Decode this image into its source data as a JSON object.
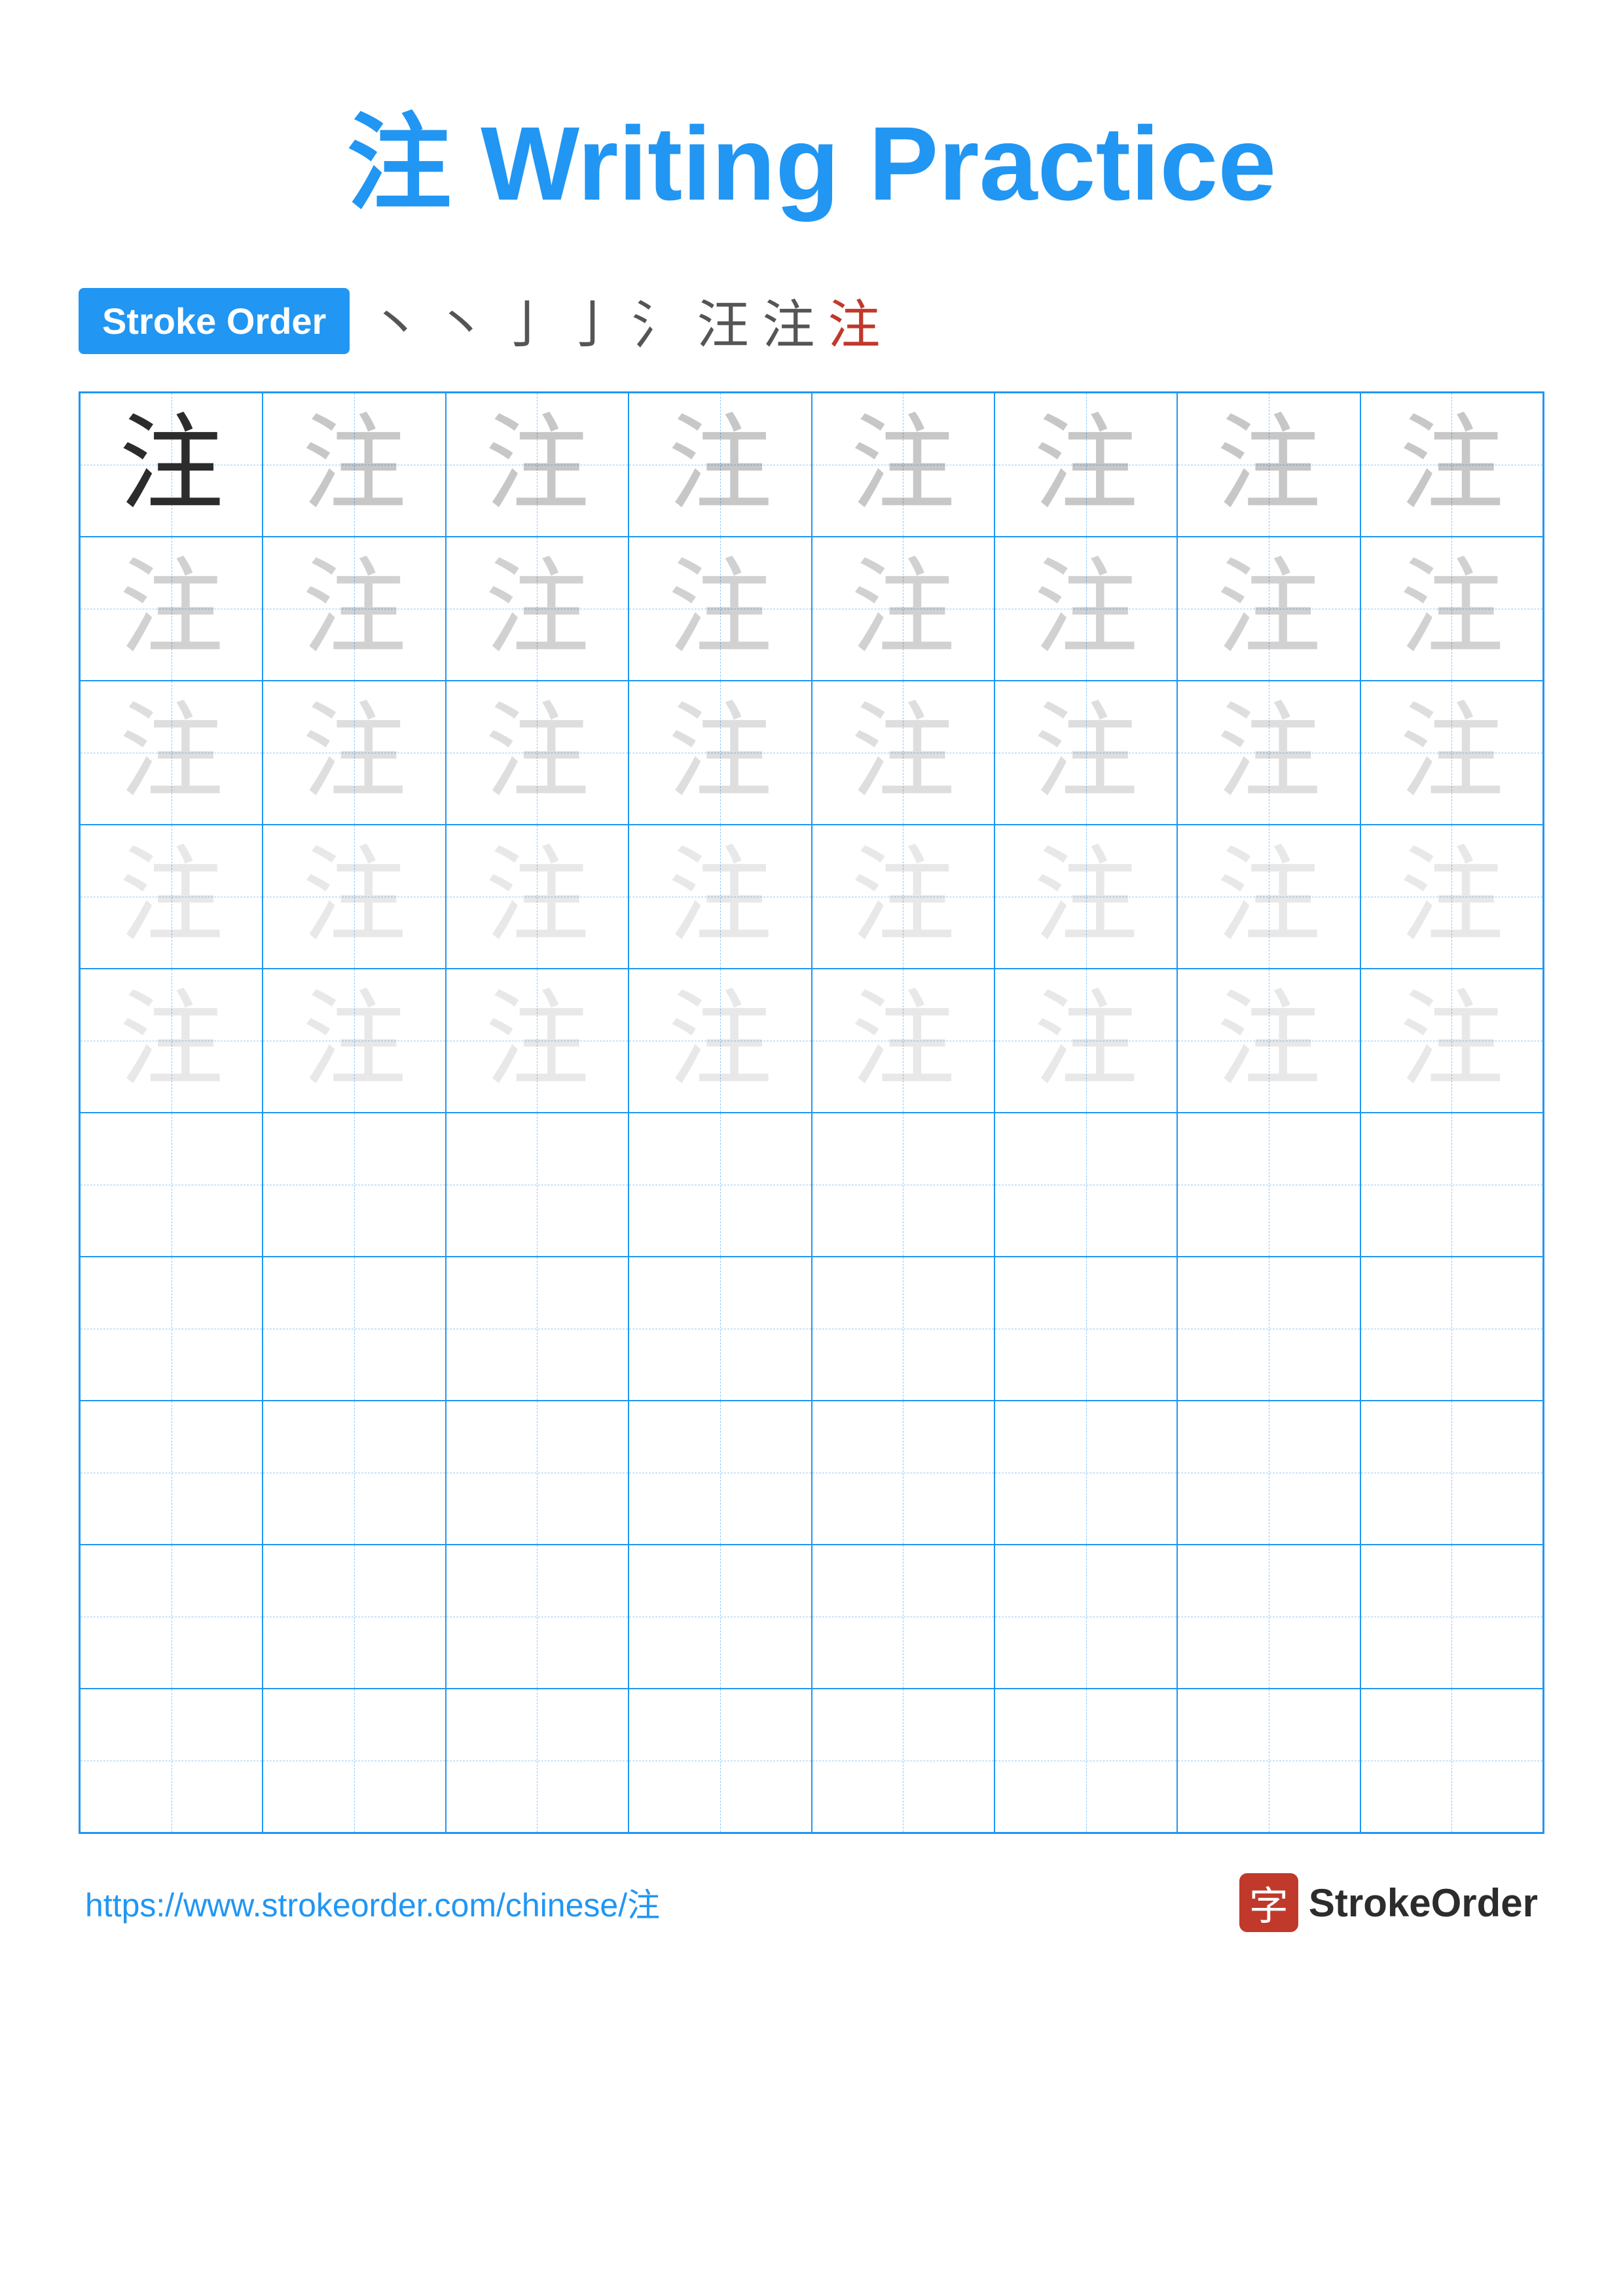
{
  "title": {
    "character": "注",
    "text": "Writing Practice",
    "full": "注 Writing Practice"
  },
  "stroke_order": {
    "badge_label": "Stroke Order",
    "strokes": [
      "丶",
      "丶",
      "亅",
      "亅",
      "氵",
      "汪",
      "注",
      "注"
    ]
  },
  "grid": {
    "rows": 10,
    "cols": 8,
    "character": "注",
    "cells": [
      {
        "row": 0,
        "col": 0,
        "opacity": "dark"
      },
      {
        "row": 0,
        "col": 1,
        "opacity": "light1"
      },
      {
        "row": 0,
        "col": 2,
        "opacity": "light1"
      },
      {
        "row": 0,
        "col": 3,
        "opacity": "light1"
      },
      {
        "row": 0,
        "col": 4,
        "opacity": "light1"
      },
      {
        "row": 0,
        "col": 5,
        "opacity": "light1"
      },
      {
        "row": 0,
        "col": 6,
        "opacity": "light1"
      },
      {
        "row": 0,
        "col": 7,
        "opacity": "light1"
      },
      {
        "row": 1,
        "col": 0,
        "opacity": "light2"
      },
      {
        "row": 1,
        "col": 1,
        "opacity": "light2"
      },
      {
        "row": 1,
        "col": 2,
        "opacity": "light2"
      },
      {
        "row": 1,
        "col": 3,
        "opacity": "light2"
      },
      {
        "row": 1,
        "col": 4,
        "opacity": "light2"
      },
      {
        "row": 1,
        "col": 5,
        "opacity": "light2"
      },
      {
        "row": 1,
        "col": 6,
        "opacity": "light2"
      },
      {
        "row": 1,
        "col": 7,
        "opacity": "light2"
      },
      {
        "row": 2,
        "col": 0,
        "opacity": "light3"
      },
      {
        "row": 2,
        "col": 1,
        "opacity": "light3"
      },
      {
        "row": 2,
        "col": 2,
        "opacity": "light3"
      },
      {
        "row": 2,
        "col": 3,
        "opacity": "light3"
      },
      {
        "row": 2,
        "col": 4,
        "opacity": "light3"
      },
      {
        "row": 2,
        "col": 5,
        "opacity": "light3"
      },
      {
        "row": 2,
        "col": 6,
        "opacity": "light3"
      },
      {
        "row": 2,
        "col": 7,
        "opacity": "light3"
      },
      {
        "row": 3,
        "col": 0,
        "opacity": "light4"
      },
      {
        "row": 3,
        "col": 1,
        "opacity": "light4"
      },
      {
        "row": 3,
        "col": 2,
        "opacity": "light4"
      },
      {
        "row": 3,
        "col": 3,
        "opacity": "light4"
      },
      {
        "row": 3,
        "col": 4,
        "opacity": "light4"
      },
      {
        "row": 3,
        "col": 5,
        "opacity": "light4"
      },
      {
        "row": 3,
        "col": 6,
        "opacity": "light4"
      },
      {
        "row": 3,
        "col": 7,
        "opacity": "light4"
      },
      {
        "row": 4,
        "col": 0,
        "opacity": "light4"
      },
      {
        "row": 4,
        "col": 1,
        "opacity": "light4"
      },
      {
        "row": 4,
        "col": 2,
        "opacity": "light4"
      },
      {
        "row": 4,
        "col": 3,
        "opacity": "light4"
      },
      {
        "row": 4,
        "col": 4,
        "opacity": "light4"
      },
      {
        "row": 4,
        "col": 5,
        "opacity": "light4"
      },
      {
        "row": 4,
        "col": 6,
        "opacity": "light4"
      },
      {
        "row": 4,
        "col": 7,
        "opacity": "light4"
      }
    ]
  },
  "footer": {
    "url": "https://www.strokeorder.com/chinese/注",
    "logo_char": "字",
    "logo_text": "StrokeOrder"
  }
}
